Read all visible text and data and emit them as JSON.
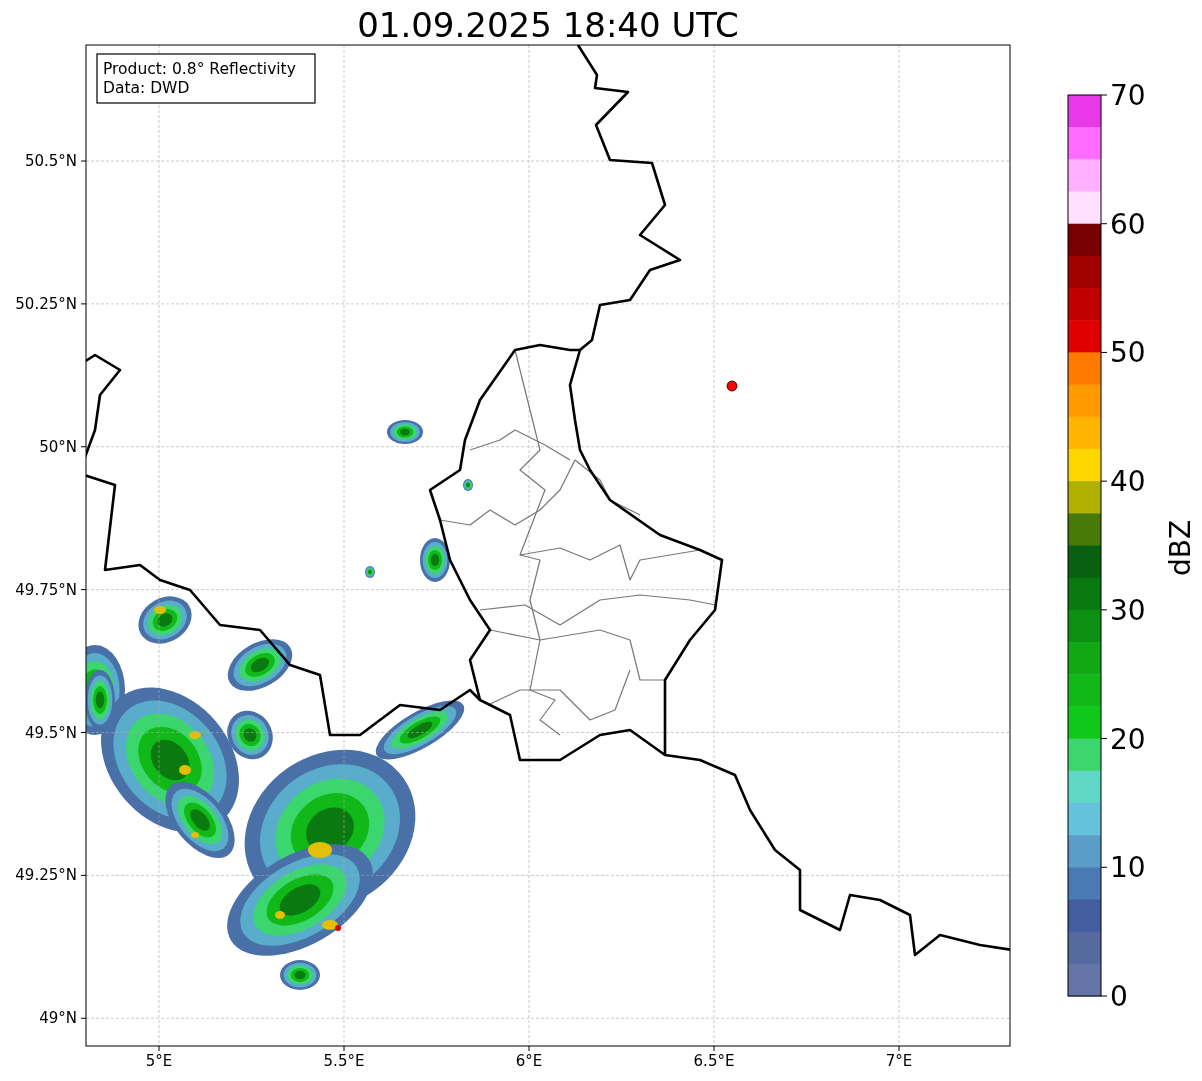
{
  "title": "01.09.2025 18:40 UTC",
  "info_box": [
    "Product: 0.8° Reflectivity",
    "Data: DWD"
  ],
  "x_ticks": [
    "5°E",
    "5.5°E",
    "6°E",
    "6.5°E",
    "7°E"
  ],
  "y_ticks": [
    "50.5°N",
    "50.25°N",
    "50°N",
    "49.75°N",
    "49.5°N",
    "49.25°N",
    "49°N"
  ],
  "colorbar": {
    "label": "dBZ",
    "ticks": [
      "70",
      "60",
      "50",
      "40",
      "30",
      "20",
      "10",
      "0"
    ],
    "bands": [
      {
        "color": "#e838e8"
      },
      {
        "color": "#ff6cff"
      },
      {
        "color": "#ffb0ff"
      },
      {
        "color": "#ffe0ff"
      },
      {
        "color": "#780000"
      },
      {
        "color": "#a00000"
      },
      {
        "color": "#c00000"
      },
      {
        "color": "#e00000"
      },
      {
        "color": "#ff7a00"
      },
      {
        "color": "#ff9a00"
      },
      {
        "color": "#ffb400"
      },
      {
        "color": "#ffd700"
      },
      {
        "color": "#b0b000"
      },
      {
        "color": "#487a0a"
      },
      {
        "color": "#086010"
      },
      {
        "color": "#0a7a10"
      },
      {
        "color": "#0c9012"
      },
      {
        "color": "#10a814"
      },
      {
        "color": "#10b818"
      },
      {
        "color": "#10c81a"
      },
      {
        "color": "#3cd66e"
      },
      {
        "color": "#60d8c8"
      },
      {
        "color": "#66c1dc"
      },
      {
        "color": "#5a9ec8"
      },
      {
        "color": "#4a7ab4"
      },
      {
        "color": "#435da0"
      },
      {
        "color": "#566aa0"
      },
      {
        "color": "#6575a8"
      }
    ]
  }
}
